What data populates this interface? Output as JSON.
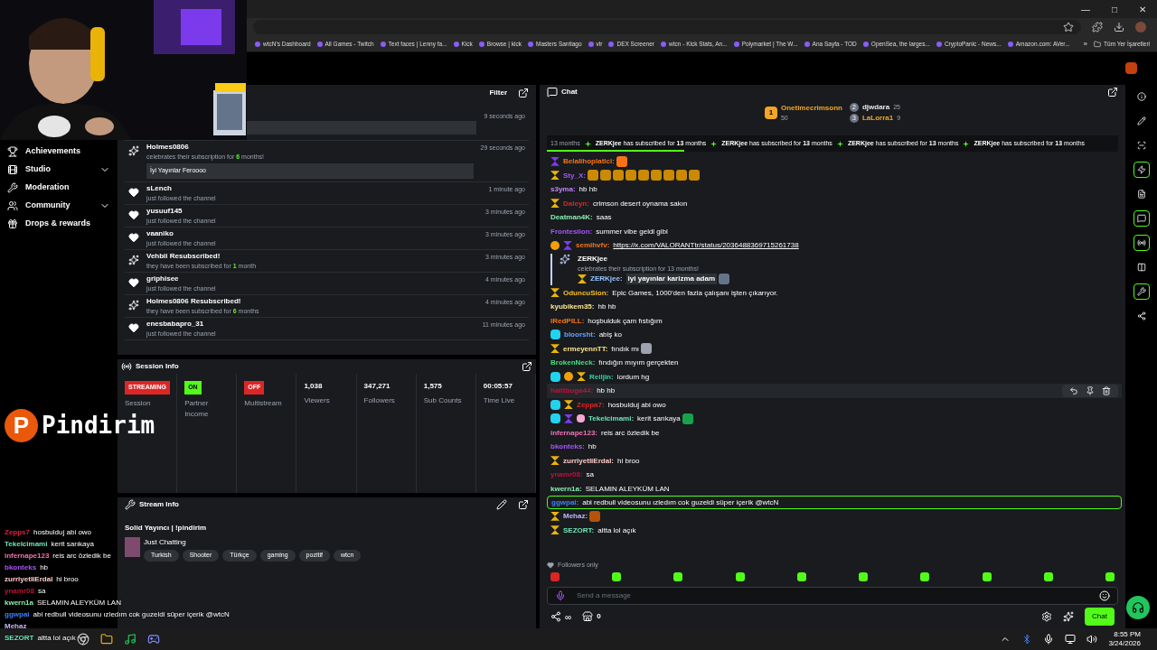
{
  "window_controls": [
    "—",
    "□",
    "✕"
  ],
  "bookmarks": [
    "wtcN's Dashboard",
    "All Games - Twitch",
    "Text faces | Lenny fa...",
    "Kick",
    "Browse | kick",
    "Masters Santiago",
    "vlr",
    "DEX Screener",
    "wtcn - Kick Stats, An...",
    "Polymarket | The W...",
    "Ana Sayfa - TOD",
    "OpenSea, the larges...",
    "CryptoPanic - News...",
    "Amazon.com: AVer..."
  ],
  "bookmarks_more": "»",
  "all_bookmarks": "Tüm Yer İşaretleri",
  "sidebar": {
    "items": [
      {
        "label": "Achievements",
        "expandable": false
      },
      {
        "label": "Studio",
        "expandable": true
      },
      {
        "label": "Moderation",
        "expandable": false
      },
      {
        "label": "Community",
        "expandable": true
      },
      {
        "label": "Drops & rewards",
        "expandable": false
      }
    ]
  },
  "activity": {
    "filter": "Filter",
    "items": [
      {
        "kind": "partial",
        "time": "9 seconds ago"
      },
      {
        "kind": "celebration",
        "name": "Holmes0806",
        "pre": "celebrates their subscription for ",
        "count": "6",
        "post": " months!",
        "time": "29 seconds ago",
        "message": "İyi Yayınlar Feroooo"
      },
      {
        "kind": "follow",
        "name": "sLench",
        "line": "just followed the channel",
        "time": "1 minute ago"
      },
      {
        "kind": "follow",
        "name": "yusuuf145",
        "line": "just followed the channel",
        "time": "3 minutes ago"
      },
      {
        "kind": "follow",
        "name": "vaaniko",
        "line": "just followed the channel",
        "time": "3 minutes ago"
      },
      {
        "kind": "resub",
        "name": "Vehbii Resubscribed!",
        "pre": "they have been subscribed for ",
        "count": "1",
        "post": " month",
        "time": "3 minutes ago"
      },
      {
        "kind": "follow",
        "name": "griphisee",
        "line": "just followed the channel",
        "time": "4 minutes ago"
      },
      {
        "kind": "resub",
        "name": "Holmes0806 Resubscribed!",
        "pre": "they have been subscribed for ",
        "count": "6",
        "post": " months",
        "time": "4 minutes ago"
      },
      {
        "kind": "follow",
        "name": "enesbabapro_31",
        "line": "just followed the channel",
        "time": "11 minutes ago"
      }
    ]
  },
  "session_info": {
    "title": "Session Info",
    "stats": [
      {
        "kind": "badge",
        "value": "STREAMING",
        "label": "Session",
        "color": "#dc2626"
      },
      {
        "kind": "badge",
        "value": "ON",
        "label": "Partner Income",
        "color": "#53fc18"
      },
      {
        "kind": "badge",
        "value": "OFF",
        "label": "Multistream",
        "color": "#dc2626"
      },
      {
        "kind": "number",
        "value": "1,038",
        "label": "Viewers"
      },
      {
        "kind": "number",
        "value": "347,271",
        "label": "Followers"
      },
      {
        "kind": "number",
        "value": "1,575",
        "label": "Sub Counts"
      },
      {
        "kind": "number",
        "value": "00:05:57",
        "label": "Time Live"
      }
    ]
  },
  "stream_info": {
    "title": "Stream Info",
    "stream_title": "Solid Yayıncı | !pindirim",
    "category": "Just Chatting",
    "tags": [
      "Turkish",
      "Shooter",
      "Türkçe",
      "gaming",
      "pozitif",
      "wtcn"
    ]
  },
  "chat": {
    "title": "Chat",
    "leaders": [
      {
        "rank": "1",
        "name": "Onetimecrimsonn",
        "count": "50",
        "color": "#f5a524"
      },
      {
        "rank": "2",
        "name": "djwdara",
        "count": "25",
        "color": "#e5e7eb"
      },
      {
        "rank": "3",
        "name": "LaLorra1",
        "count": "9",
        "color": "#f5a524"
      }
    ],
    "ticker": {
      "lead": "13 months",
      "items": [
        {
          "name": "ZERKjee",
          "text": " has subscribed for ",
          "bold": "13",
          "tail": " months"
        },
        {
          "name": "ZERKjee",
          "text": " has subscribed for ",
          "bold": "13",
          "tail": " months"
        },
        {
          "name": "ZERKjee",
          "text": " has subscribed for ",
          "bold": "13",
          "tail": " months"
        },
        {
          "name": "ZERKjee",
          "text": " has subscribed for ",
          "bold": "13",
          "tail": " months"
        }
      ],
      "level": 0.24
    },
    "messages": [
      {
        "kind": "msg",
        "badges": [
          {
            "kind": "founder"
          }
        ],
        "user": "Belalihoplatici:",
        "color": "#f97316",
        "emotes": [
          {
            "color": "#f97316"
          }
        ]
      },
      {
        "kind": "msg",
        "badges": [
          {
            "kind": "sub"
          }
        ],
        "user": "Sty_X:",
        "color": "#a855f7",
        "emotes": [
          {
            "color": "#ca8a04"
          },
          {
            "color": "#ca8a04"
          },
          {
            "color": "#ca8a04"
          },
          {
            "color": "#ca8a04"
          },
          {
            "color": "#ca8a04"
          },
          {
            "color": "#ca8a04"
          },
          {
            "color": "#ca8a04"
          },
          {
            "color": "#ca8a04"
          },
          {
            "color": "#ca8a04"
          }
        ]
      },
      {
        "kind": "msg",
        "user": "s3yma:",
        "color": "#c084fc",
        "text": "hb hb"
      },
      {
        "kind": "msg",
        "badges": [
          {
            "kind": "sub"
          }
        ],
        "user": "Daleyn:",
        "color": "#dc2626",
        "text": "crimson desert oynama sakın"
      },
      {
        "kind": "msg",
        "user": "Deatman4K:",
        "color": "#86efac",
        "text": "saas"
      },
      {
        "kind": "msg",
        "user": "Frontesiion:",
        "color": "#a855f7",
        "text": "summer vibe geldi gibi"
      },
      {
        "kind": "link",
        "badges": [
          {
            "kind": "rank"
          },
          {
            "kind": "founder"
          }
        ],
        "user": "semihvfv:",
        "color": "#f97316",
        "text": "https://x.com/VALORANTtr/status/2036488369715261738"
      },
      {
        "kind": "sub",
        "user": "ZERKjee",
        "line": "celebrates their subscription for 13 months!",
        "quote_user": "ZERKjee:",
        "quote": "iyi yayınlar karizma adam",
        "color": "#93c5fd"
      },
      {
        "kind": "msg",
        "badges": [
          {
            "kind": "sub"
          }
        ],
        "user": "OduncuSion:",
        "color": "#fbbf24",
        "text": "Epic Games, 1000'den fazla çalışanı işten çıkarıyor."
      },
      {
        "kind": "msg",
        "user": "kyubikem35:",
        "color": "#fde68a",
        "text": "hb hb"
      },
      {
        "kind": "msg",
        "user": "lRedPILL:",
        "color": "#f97316",
        "text": "hoşbulduk çam fıstığım"
      },
      {
        "kind": "msg",
        "badges": [
          {
            "kind": "og"
          }
        ],
        "user": "bloorsht:",
        "color": "#60a5fa",
        "text": "abiş ko"
      },
      {
        "kind": "msg",
        "badges": [
          {
            "kind": "sub"
          }
        ],
        "user": "ermeyennTT:",
        "color": "#fde68a",
        "text": "fındık mı",
        "emotes": [
          {
            "color": "#9ca3af"
          }
        ]
      },
      {
        "kind": "msg",
        "user": "BrokenNeck:",
        "color": "#4ade80",
        "text": "fındığın mıyım gerçekten"
      },
      {
        "kind": "msg",
        "badges": [
          {
            "kind": "og"
          },
          {
            "kind": "rank"
          },
          {
            "kind": "sub"
          }
        ],
        "user": "Reiljin:",
        "color": "#34d399",
        "text": "lordum hg"
      },
      {
        "kind": "msg",
        "user": "halitbuga44:",
        "color": "#be123c",
        "text": "hb hb",
        "hovered": true
      },
      {
        "kind": "msg",
        "badges": [
          {
            "kind": "og"
          },
          {
            "kind": "sub"
          }
        ],
        "user": "Zeppa7:",
        "color": "#dc2626",
        "text": "hosbulduj abi owo"
      },
      {
        "kind": "msg",
        "badges": [
          {
            "kind": "og"
          },
          {
            "kind": "founder"
          },
          {
            "kind": "gifts"
          }
        ],
        "user": "Tekelcimami:",
        "color": "#6ee7b7",
        "text": "kerit sarıkaya",
        "emotes": [
          {
            "color": "#16a34a"
          }
        ]
      },
      {
        "kind": "msg",
        "user": "infernape123:",
        "color": "#f472b6",
        "text": "reis arc özledik be"
      },
      {
        "kind": "msg",
        "user": "bkonteks:",
        "color": "#a855f7",
        "text": "hb"
      },
      {
        "kind": "msg",
        "badges": [
          {
            "kind": "sub"
          }
        ],
        "user": "zurriyetliErdal:",
        "color": "#fecaca",
        "text": "hi broo"
      },
      {
        "kind": "msg",
        "user": "ynamr08:",
        "color": "#be123c",
        "text": "sa"
      },
      {
        "kind": "msg",
        "user": "kwern1a:",
        "color": "#86efac",
        "text": "SELAMIN ALEYKÜM LAN"
      },
      {
        "kind": "msg",
        "user": "ggwpai:",
        "color": "#3b82f6",
        "text": "abi redbull videosunu ızledım cok guzeldi süper içerik @wtcN",
        "mention": true
      },
      {
        "kind": "msg",
        "badges": [
          {
            "kind": "sub"
          }
        ],
        "user": "Mehaz:",
        "color": "#c4b5fd",
        "emotes": [
          {
            "color": "#b45309"
          }
        ]
      },
      {
        "kind": "msg",
        "badges": [
          {
            "kind": "sub"
          }
        ],
        "user": "SEZORT:",
        "color": "#6ee7b7",
        "text": "altta lol açık"
      }
    ],
    "followers_only": "Followers only",
    "emote_bar": [
      {
        "color": "#dc2626"
      },
      {
        "color": "#53fc18"
      },
      {
        "color": "#53fc18"
      },
      {
        "color": "#53fc18"
      },
      {
        "color": "#53fc18"
      },
      {
        "color": "#53fc18"
      },
      {
        "color": "#53fc18"
      },
      {
        "color": "#53fc18"
      },
      {
        "color": "#53fc18"
      },
      {
        "color": "#53fc18"
      }
    ],
    "placeholder": "Send a message",
    "points": "∞",
    "store_count": "0",
    "send": "Chat"
  },
  "overlay": {
    "logo_letter": "P",
    "logo_text": "Pindirim",
    "chat": [
      {
        "user": "Zepps7",
        "color": "#e11d48",
        "text": "hosbulduj abi owo"
      },
      {
        "user": "Tekelcimami",
        "color": "#6ee7b7",
        "text": "kerit sarıkaya"
      },
      {
        "user": "infernape123",
        "color": "#f472b6",
        "text": "reis arc özledik be"
      },
      {
        "user": "bkonteks",
        "color": "#a855f7",
        "text": "hb"
      },
      {
        "user": "zurriyetliErdal",
        "color": "#fecaca",
        "text": "hi broo"
      },
      {
        "user": "ynamr08",
        "color": "#be123c",
        "text": "sa"
      },
      {
        "user": "kwern1a",
        "color": "#86efac",
        "text": "SELAMIN ALEYKÜM LAN"
      },
      {
        "user": "ggwpai",
        "color": "#3b82f6",
        "text": "abi redbull videosunu ızledım cok guzeldi süper içerik @wtcN"
      },
      {
        "user": "Mehaz",
        "color": "#c4b5fd"
      },
      {
        "user": "SEZORT",
        "color": "#6ee7b7",
        "text": "altta lol açık"
      }
    ]
  },
  "taskbar": {
    "time": "8:55 PM",
    "date": "3/24/2026"
  }
}
